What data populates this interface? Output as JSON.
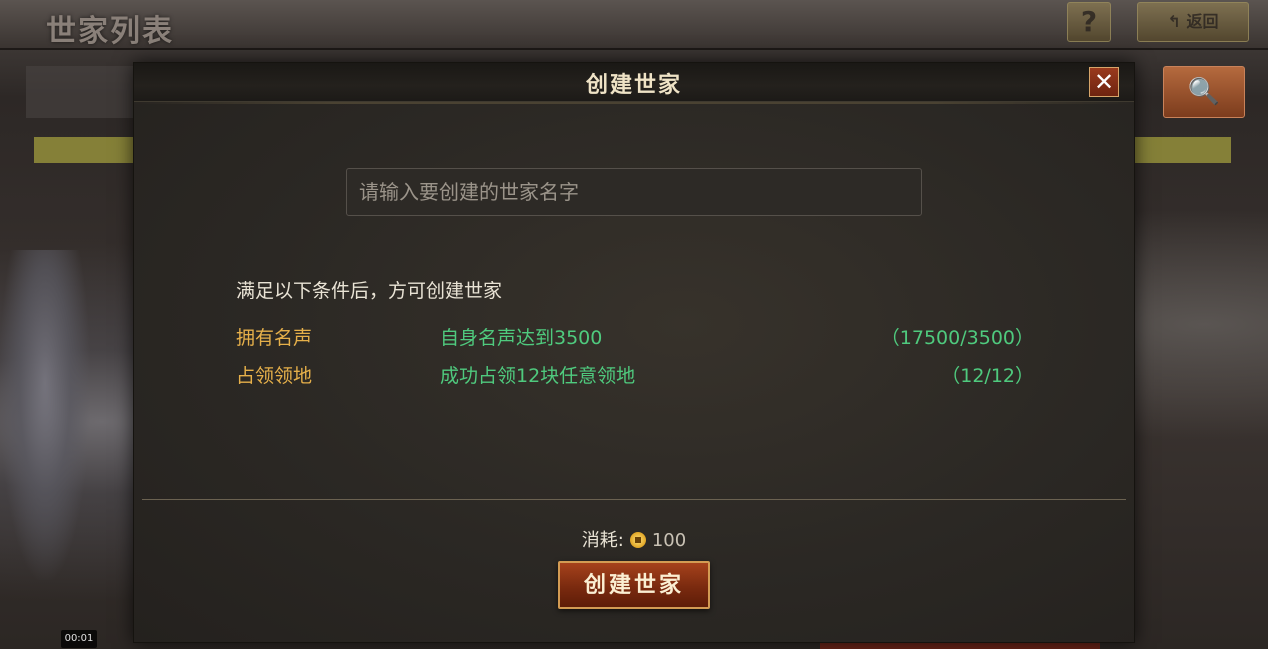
{
  "background": {
    "screen_title": "世家列表",
    "help_icon": "?",
    "back_label": "↰ 返回",
    "search_icon": "search-icon"
  },
  "dialog": {
    "title": "创建世家",
    "close_icon": "✕",
    "name_input": {
      "placeholder": "请输入要创建的世家名字",
      "value": ""
    },
    "conditions_title": "满足以下条件后，方可创建世家",
    "conditions": [
      {
        "name": "拥有名声",
        "description": "自身名声达到3500",
        "progress": "（17500/3500）"
      },
      {
        "name": "占领领地",
        "description": "成功占领12块任意领地",
        "progress": "（12/12）"
      }
    ],
    "cost_label": "消耗:",
    "cost_value": "100",
    "create_button": "创建世家"
  },
  "video_timestamp": "00:01",
  "colors": {
    "condition_name": "#e6b04a",
    "condition_met": "#4fca7e",
    "button": "#7a2a0f",
    "close_button": "#9a3a1d"
  }
}
